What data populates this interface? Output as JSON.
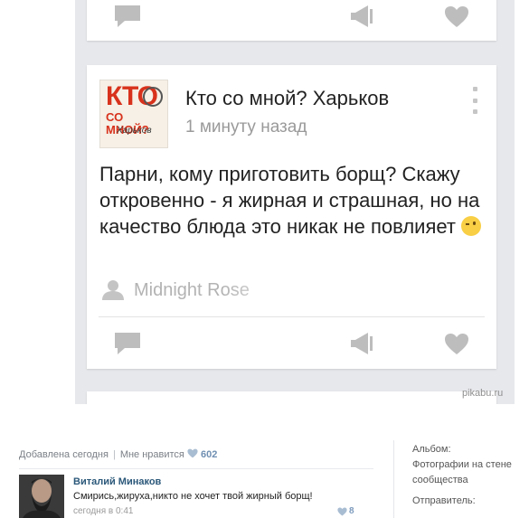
{
  "post": {
    "group_name": "Кто со мной? Харьков",
    "time": "1 минуту назад",
    "avatar": {
      "line1": "КТО",
      "line2": "СО МНОЙ?",
      "line3": "Харьков"
    },
    "text": "Парни, кому приготовить борщ? Скажу откровенно - я жирная и страшная, но на качество блюда это никак не повлияет",
    "emoji": "wink-emoji",
    "author": "Midnight Rose"
  },
  "watermark": "pikabu.ru",
  "footer": {
    "added": "Добавлена сегодня",
    "like_label": "Мне нравится",
    "like_count": "602",
    "comment": {
      "name": "Виталий Минаков",
      "text": "Смирись,жируха,никто не хочет твой жирный борщ!",
      "time": "сегодня в 0:41",
      "likes": "8"
    },
    "sidebar": {
      "album_label": "Альбом:",
      "album_value": "Фотографии на стене сообщества",
      "sender_label": "Отправитель:"
    }
  },
  "colors": {
    "background": "#e7e8ec",
    "icon_gray": "#bdbdbd",
    "link_blue": "#2b587a"
  }
}
